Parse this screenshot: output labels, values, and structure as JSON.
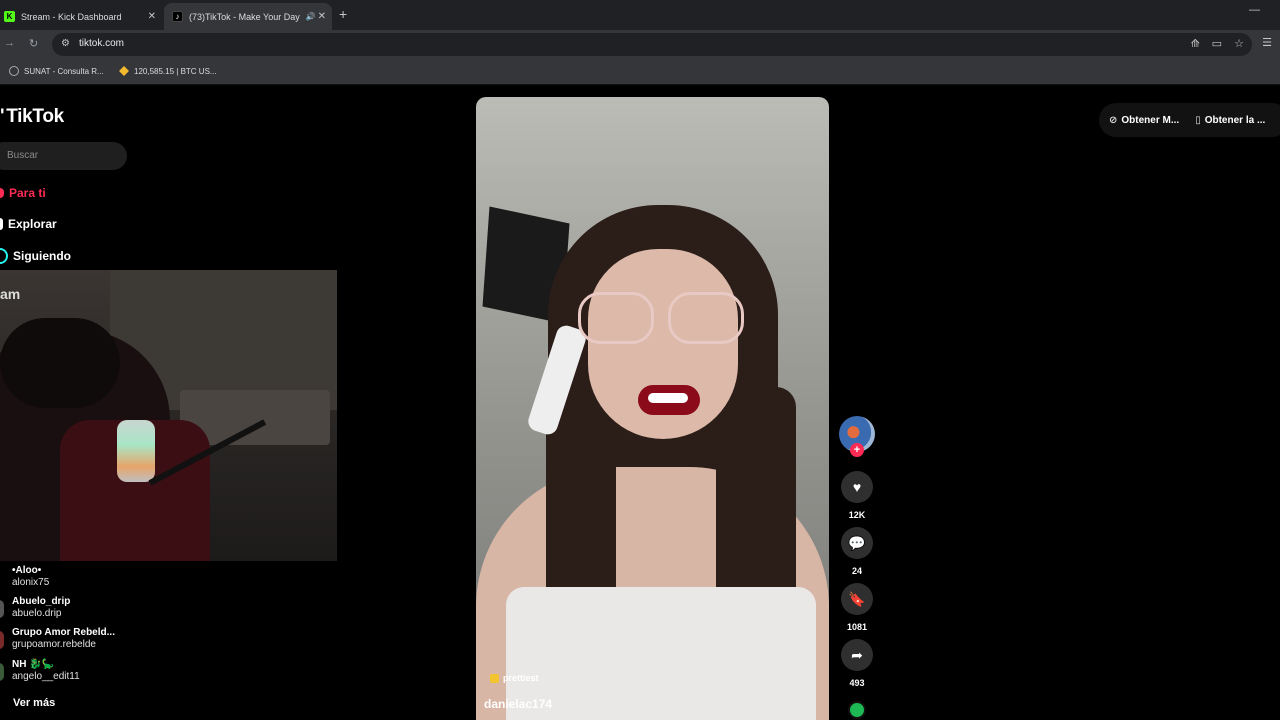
{
  "browser": {
    "tabs": [
      {
        "title": "Stream - Kick Dashboard",
        "favicon": "K"
      },
      {
        "title": "(73)TikTok - Make Your Day",
        "favicon": "♪"
      }
    ],
    "url": "tiktok.com",
    "bookmarks": [
      {
        "label": "SUNAT - Consulta R..."
      },
      {
        "label": "120,585.15 | BTC US..."
      }
    ]
  },
  "tiktok": {
    "logo_text": "TikTok",
    "search_placeholder": "Buscar",
    "nav": {
      "para_ti": "Para ti",
      "explorar": "Explorar",
      "siguiendo": "Siguiendo"
    },
    "cam_title": "am",
    "following": [
      {
        "name": "•Aloo•",
        "username": "alonix75"
      },
      {
        "name": "Abuelo_drip",
        "username": "abuelo.drip"
      },
      {
        "name": "Grupo Amor Rebeld...",
        "username": "grupoamor.rebelde"
      },
      {
        "name": "NH 🐉🦕",
        "username": "angelo__edit11"
      }
    ],
    "ver_mas": "Ver más",
    "video": {
      "author": "danielac174",
      "sound_tag": "prettiest",
      "likes": "12K",
      "comments": "24",
      "saves": "1081",
      "shares": "493"
    },
    "top_buttons": {
      "get_app": "Obtener M...",
      "get_pc": "Obtener la ..."
    }
  }
}
